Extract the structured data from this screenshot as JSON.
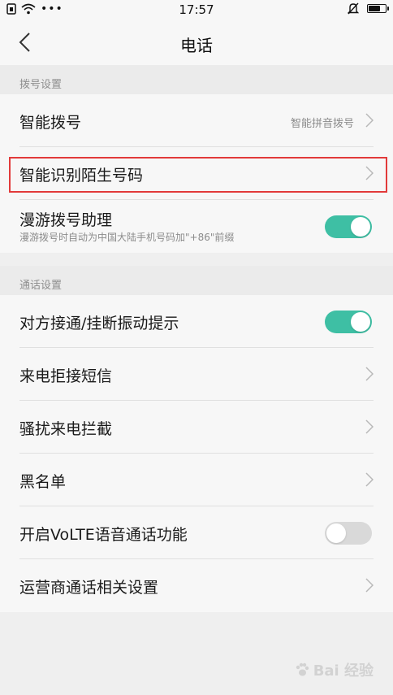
{
  "status": {
    "time": "17:57",
    "dots": "•••"
  },
  "nav": {
    "title": "电话"
  },
  "sections": [
    {
      "header": "拨号设置"
    },
    {
      "header": "通话设置"
    }
  ],
  "items": {
    "smart_dial": {
      "label": "智能拨号",
      "value": "智能拼音拨号"
    },
    "identify_unknown": {
      "label": "智能识别陌生号码"
    },
    "roaming_assistant": {
      "label": "漫游拨号助理",
      "sublabel": "漫游拨号时自动为中国大陆手机号码加\"+86\"前缀",
      "enabled": true
    },
    "vibrate_on_connect": {
      "label": "对方接通/挂断振动提示",
      "enabled": true
    },
    "reject_sms": {
      "label": "来电拒接短信"
    },
    "harass_block": {
      "label": "骚扰来电拦截"
    },
    "blacklist": {
      "label": "黑名单"
    },
    "volte": {
      "label": "开启VoLTE语音通话功能",
      "enabled": false
    },
    "carrier_settings": {
      "label": "运营商通话相关设置"
    }
  },
  "colors": {
    "toggle_on": "#3ebfa4",
    "toggle_off": "#d9d9d9",
    "highlight": "#e23a3a"
  },
  "watermark": {
    "text": "Bai 经验"
  }
}
